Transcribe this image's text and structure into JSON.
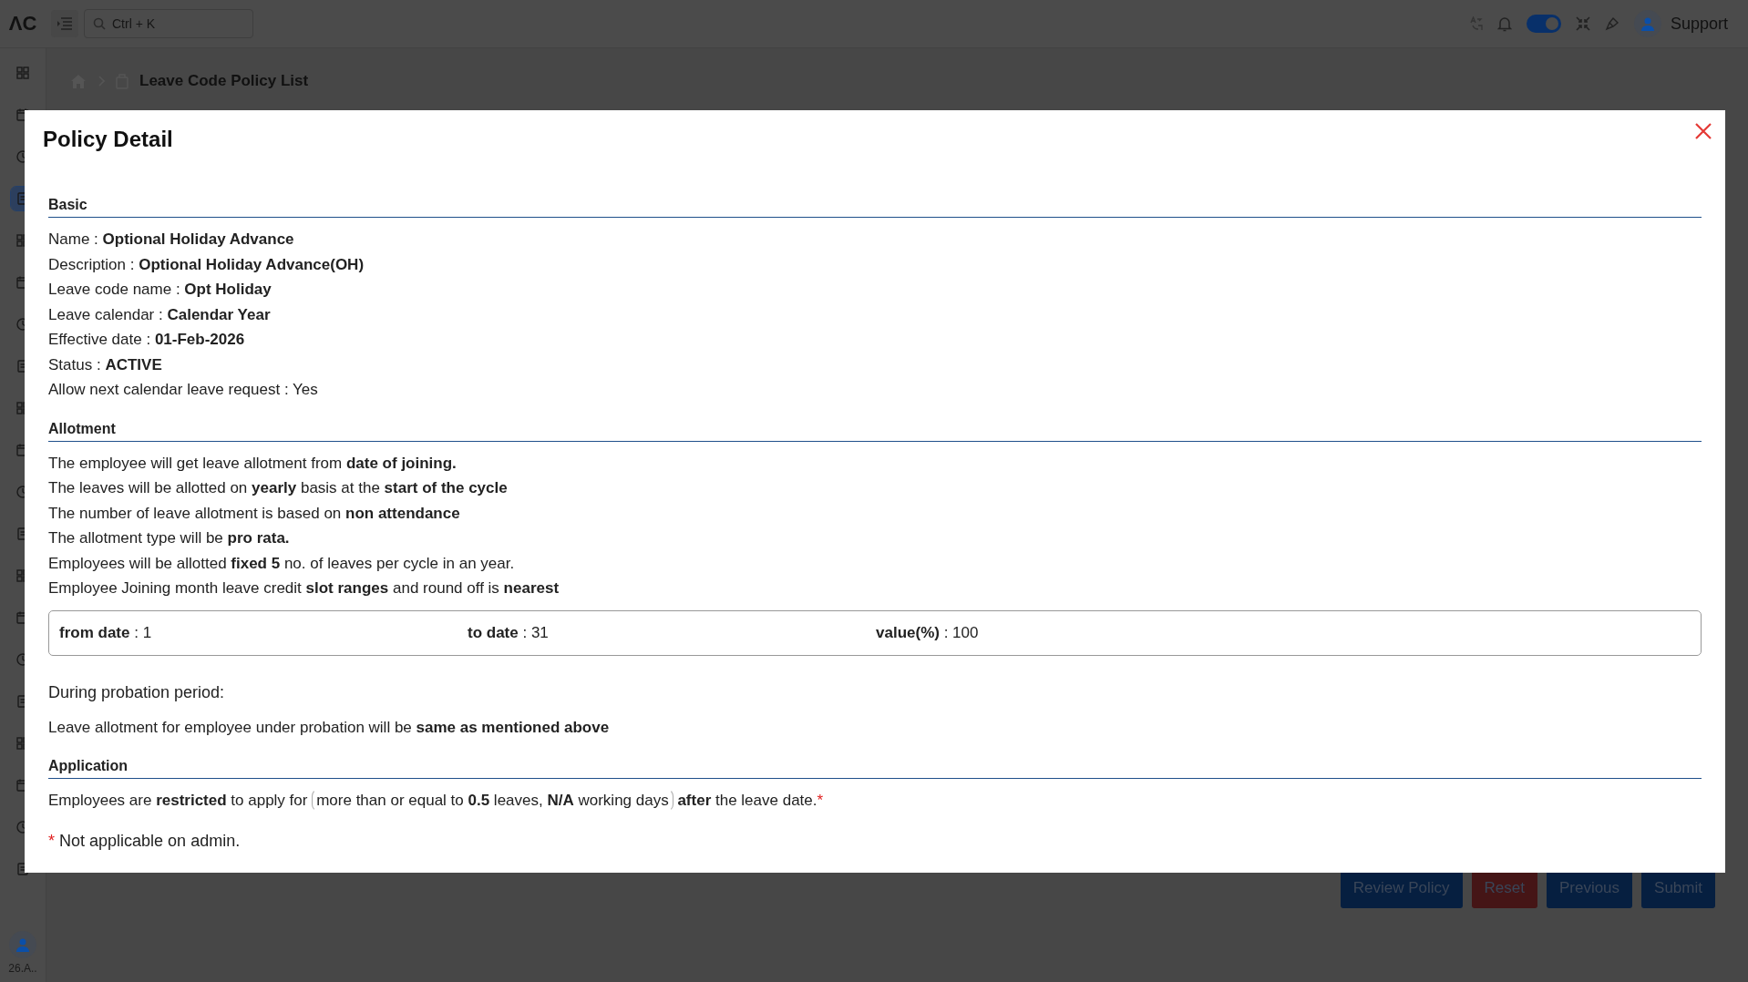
{
  "topbar": {
    "logo": "ΛC",
    "search": {
      "placeholder": "Ctrl + K"
    },
    "theme_toggle": {
      "on": true
    },
    "user": "Support"
  },
  "sidebar": {
    "items": [
      {
        "selected": false
      },
      {
        "selected": false
      },
      {
        "selected": false
      },
      {
        "selected": true
      },
      {
        "selected": false
      },
      {
        "selected": false
      },
      {
        "selected": false
      },
      {
        "selected": false
      },
      {
        "selected": false
      },
      {
        "selected": false
      },
      {
        "selected": false
      },
      {
        "selected": false
      },
      {
        "selected": false
      },
      {
        "selected": false
      },
      {
        "selected": false
      },
      {
        "selected": false
      },
      {
        "selected": false
      },
      {
        "selected": false
      },
      {
        "selected": false
      },
      {
        "selected": false
      }
    ],
    "user_label": "26.A.."
  },
  "breadcrumb": {
    "current": "Leave Code Policy List"
  },
  "footer_buttons": [
    {
      "label": "Review Policy",
      "kind": "primary"
    },
    {
      "label": "Reset",
      "kind": "danger"
    },
    {
      "label": "Previous",
      "kind": "primary"
    },
    {
      "label": "Submit",
      "kind": "primary"
    }
  ],
  "modal": {
    "title": "Policy Detail",
    "sections": [
      {
        "heading": "Basic",
        "lines": [
          "Name : **Optional Holiday Advance**",
          "Description : **Optional Holiday Advance(OH)**",
          "Leave code name : **Opt Holiday**",
          "Leave calendar : **Calendar Year**",
          "Effective date : **01-Feb-2026**",
          "Status : **ACTIVE**",
          "Allow next calendar leave request : Yes"
        ]
      },
      {
        "heading": "Allotment",
        "lines": [
          "The employee will get leave allotment from **date of joining.**",
          "The leaves will be allotted on **yearly** basis at the **start of the cycle**",
          "The number of leave allotment is based on **non attendance**",
          "The allotment type will be **pro rata.**",
          "Employees will be allotted **fixed 5** no. of leaves per cycle in an year.",
          "Employee Joining month leave credit **slot ranges** and round off is **nearest**"
        ],
        "slots": [
          [
            "**from date** : 1",
            "**to date** : 31",
            "**value(%)** : 100"
          ]
        ],
        "probation_title": "During probation period:",
        "probation_text": "Leave allotment for employee under probation will be **same as mentioned above**"
      },
      {
        "heading": "Application",
        "rule": {
          "before": "Employees are **restricted** to apply for",
          "bracket": "more than or equal to **0.5** leaves, **N/A** working days",
          "after": "**after** the leave date.",
          "mark": "*"
        }
      }
    ],
    "footnote": {
      "mark": "*",
      "text": "Not applicable on admin."
    }
  }
}
